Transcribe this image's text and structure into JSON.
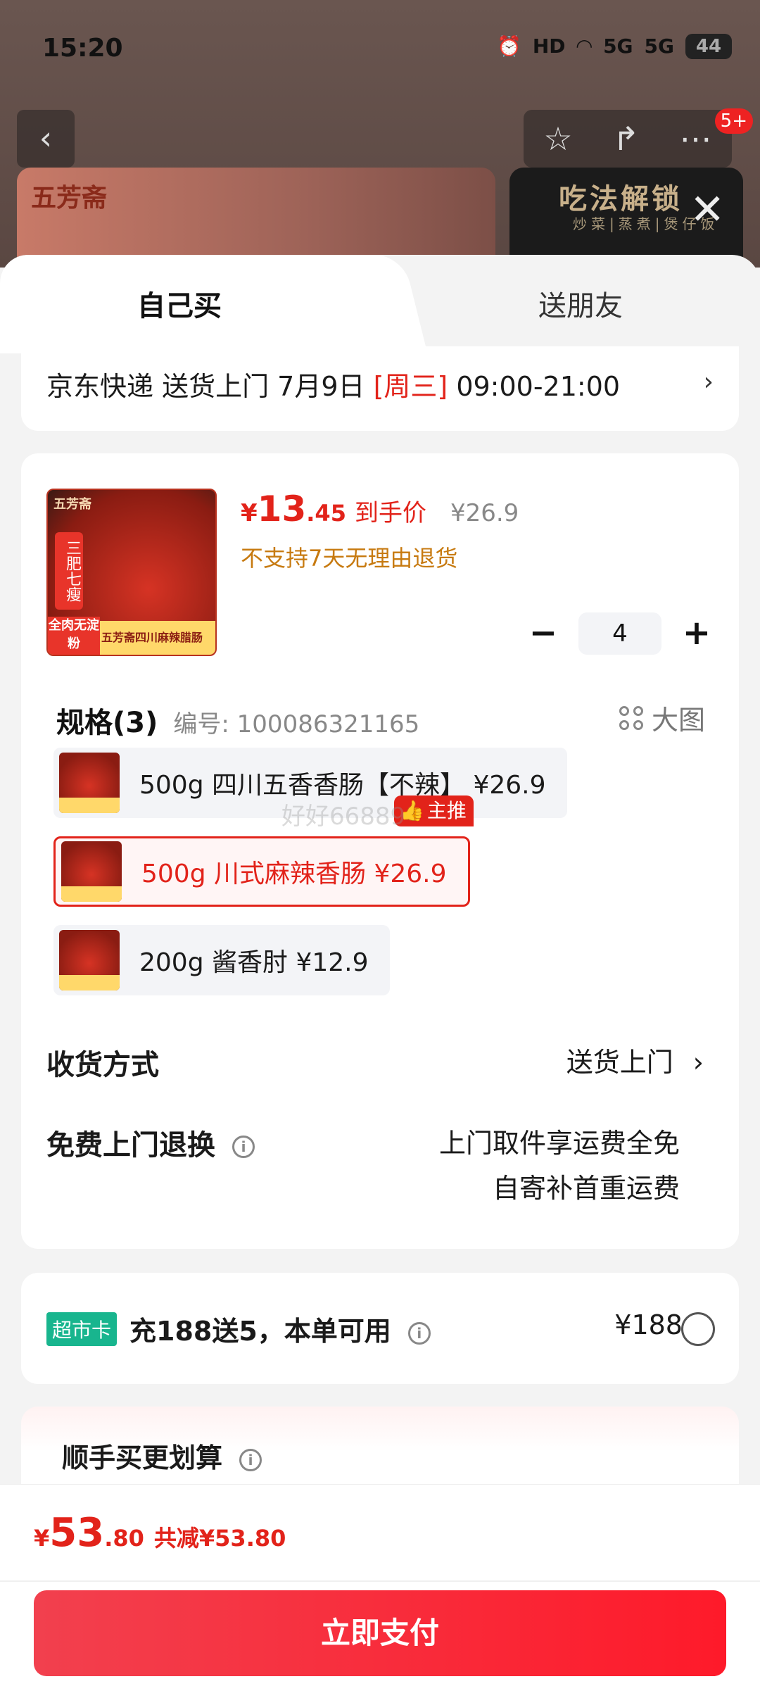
{
  "status_bar": {
    "time": "15:20",
    "network": "HD",
    "signal_1": "5G",
    "signal_2": "5G",
    "battery": "44"
  },
  "background": {
    "notification_badge": "5+",
    "banner_left_brand": "五芳斋",
    "banner_right_title": "吃法解锁",
    "banner_right_subtitle": "炒菜|蒸煮|煲仔饭"
  },
  "tabs": [
    {
      "label": "自己买"
    },
    {
      "label": "送朋友"
    }
  ],
  "delivery": {
    "text_before": "京东快递 送货上门 7月9日 ",
    "weekday": "[周三]",
    "time_range": " 09:00-21:00"
  },
  "product": {
    "image_brand": "五芳斋",
    "image_tag": "三肥七瘦",
    "image_red_label": "全肉无淀粉",
    "image_strip_text": "五芳斋四川麻辣腊肠",
    "price_yen": "¥",
    "price_int": "13",
    "price_dec": ".45",
    "price_label": "到手价",
    "original_price": "¥26.9",
    "return_policy": "不支持7天无理由退货",
    "quantity": "4",
    "minus": "−",
    "plus": "+"
  },
  "specs": {
    "title": "规格(3)",
    "code": "编号: 100086321165",
    "big_view": "大图",
    "items": [
      {
        "label": "500g 四川五香香肠【不辣】  ¥26.9"
      },
      {
        "label": "500g 川式麻辣香肠  ¥26.9"
      },
      {
        "label": "200g 酱香肘  ¥12.9"
      }
    ],
    "recommended_badge": "主推",
    "watermark": "好好66889"
  },
  "shipping": {
    "label": "收货方式",
    "value": "送货上门"
  },
  "free_return": {
    "label": "免费上门退换",
    "value_line1": "上门取件享运费全免",
    "value_line2": "自寄补首重运费"
  },
  "supermarket_card": {
    "badge": "超市卡",
    "text": "充188送5，本单可用",
    "price": "¥188"
  },
  "extra": {
    "title": "顺手买更划算"
  },
  "footer": {
    "total_yen": "¥",
    "total_int": "53",
    "total_dec": ".80",
    "savings": "共减¥53.80",
    "pay_label": "立即支付"
  },
  "colors": {
    "accent": "#e2231a",
    "pay_button": "#fe1a2a",
    "card_badge": "#18b58e",
    "warning": "#c77a10"
  }
}
